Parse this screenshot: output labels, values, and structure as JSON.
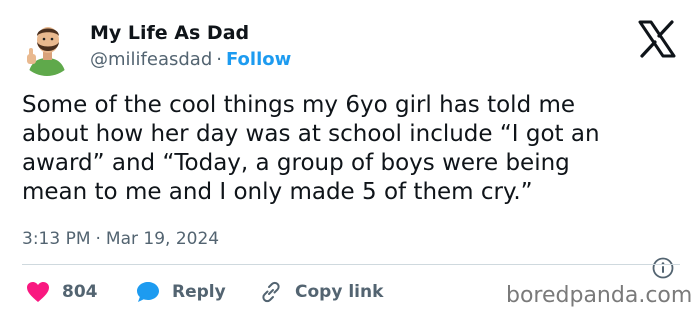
{
  "author": {
    "display_name": "My Life As Dad",
    "handle": "@milifeasdad",
    "separator": "·",
    "follow_label": "Follow",
    "avatar_icon": "bearded-man-thumbs-up-avatar"
  },
  "tweet": {
    "text": "Some of the cool things my 6yo girl has told me\nabout how her day was at school include “I got an\naward” and “Today, a group of boys were being\nmean to me and I only made 5 of them cry.”",
    "time": "3:13 PM",
    "separator": "·",
    "date": "Mar 19, 2024"
  },
  "actions": {
    "likes_count": "804",
    "reply_label": "Reply",
    "copy_link_label": "Copy link"
  },
  "icons": {
    "brand": "x-logo-icon",
    "info": "info-icon",
    "like": "heart-icon",
    "reply": "speech-bubble-icon",
    "copy": "link-icon"
  },
  "colors": {
    "text": "#0f1419",
    "secondary": "#536471",
    "accent": "#1d9bf0",
    "like": "#f91880"
  },
  "watermark": "boredpanda.com"
}
